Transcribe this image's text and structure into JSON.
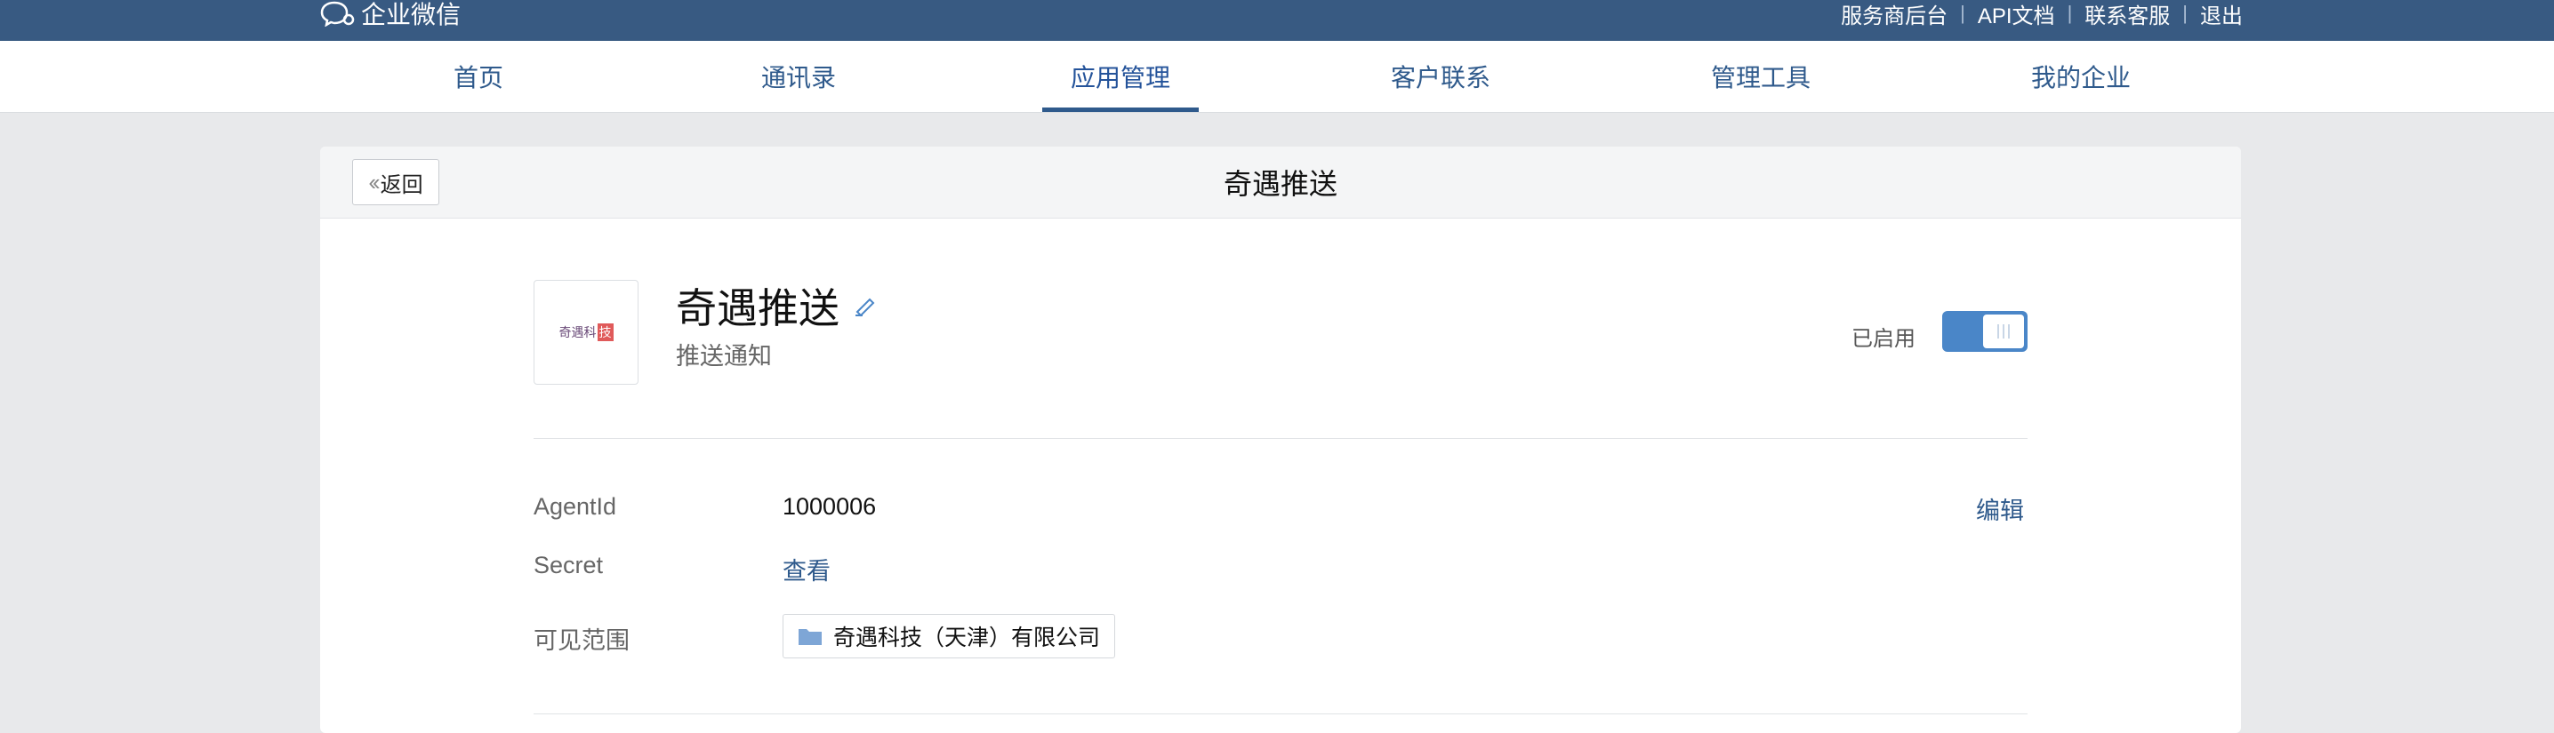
{
  "topbar": {
    "logo_text": "企业微信",
    "links": [
      "服务商后台",
      "API文档",
      "联系客服",
      "退出"
    ]
  },
  "nav": {
    "tabs": [
      "首页",
      "通讯录",
      "应用管理",
      "客户联系",
      "管理工具",
      "我的企业"
    ],
    "active_index": 2
  },
  "card": {
    "back_label": "返回",
    "title": "奇遇推送"
  },
  "app": {
    "icon_text": "奇遇科",
    "icon_badge": "技",
    "name": "奇遇推送",
    "description": "推送通知",
    "status_label": "已启用",
    "enabled": true
  },
  "fields": {
    "agentid_label": "AgentId",
    "agentid_value": "1000006",
    "secret_label": "Secret",
    "secret_action": "查看",
    "scope_label": "可见范围",
    "scope_value": "奇遇科技（天津）有限公司",
    "edit_label": "编辑"
  },
  "colors": {
    "topbar": "#385a82",
    "accent": "#2f5a8c",
    "toggle_on": "#4a86c8"
  }
}
